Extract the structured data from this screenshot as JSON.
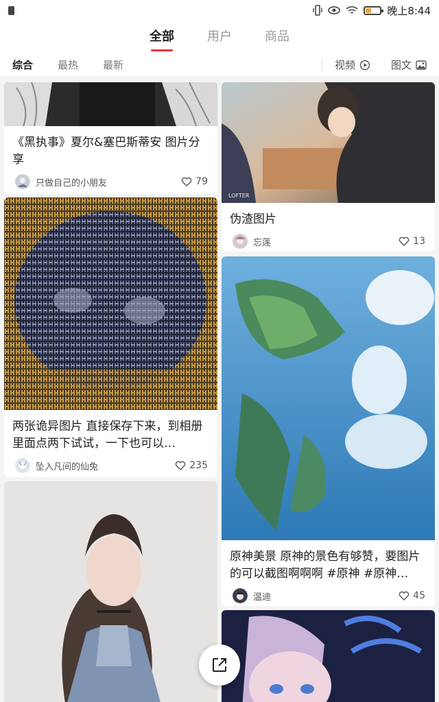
{
  "status_bar": {
    "time": "晚上8:44",
    "battery_percent": 35
  },
  "top_tabs": [
    {
      "label": "全部",
      "active": true
    },
    {
      "label": "用户",
      "active": false
    },
    {
      "label": "商品",
      "active": false
    }
  ],
  "filter_tabs": [
    {
      "label": "综合",
      "active": true
    },
    {
      "label": "最热",
      "active": false
    },
    {
      "label": "最新",
      "active": false
    }
  ],
  "filter_right": {
    "video_label": "视频",
    "image_text_label": "图文"
  },
  "posts": [
    {
      "title": "《黑执事》夏尔&塞巴斯蒂安 图片分享",
      "author": "只做自己的小朋友",
      "likes": "79"
    },
    {
      "title": "伪渣图片",
      "author": "忘莲",
      "likes": "13"
    },
    {
      "title": "两张诡异图片 直接保存下来，到相册里面点两下试试，一下也可以…",
      "author": "坠入凡间的仙兔",
      "likes": "235"
    },
    {
      "title": "原神美景 原神的景色有够赞，要图片的可以截图啊啊啊 #原神 #原神…",
      "author": "温迪",
      "likes": "45"
    }
  ],
  "colors": {
    "accent": "#e8353f",
    "background": "#f4f4f4"
  }
}
